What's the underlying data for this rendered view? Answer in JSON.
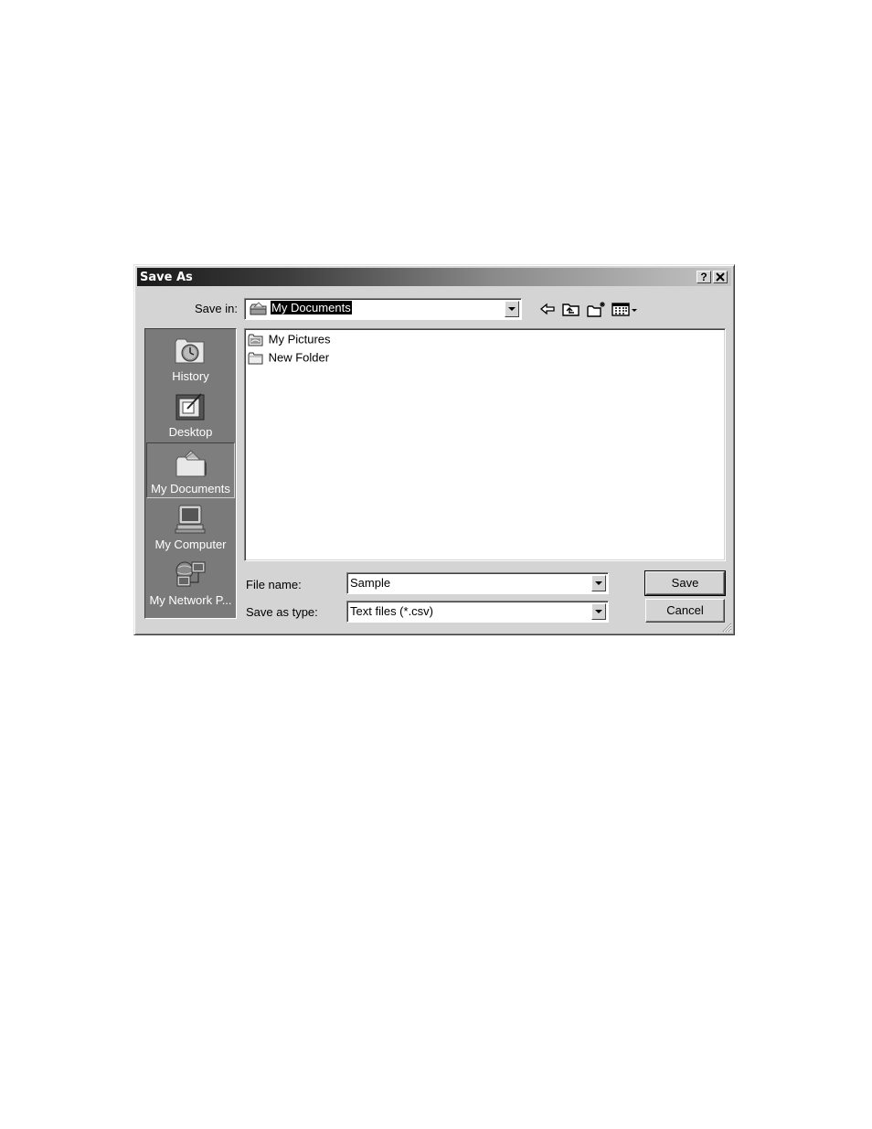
{
  "dialog": {
    "title": "Save As",
    "help_button": "?",
    "close_button": "✕"
  },
  "toolbar": {
    "save_in_label": "Save in:",
    "save_in_value": "My Documents",
    "save_in_icon": "my-documents-folder-icon",
    "buttons": [
      {
        "name": "back",
        "icon": "back-arrow-icon"
      },
      {
        "name": "up-one-level",
        "icon": "up-folder-icon"
      },
      {
        "name": "create-new-folder",
        "icon": "new-folder-icon"
      },
      {
        "name": "view-menu",
        "icon": "view-menu-icon"
      }
    ]
  },
  "places": [
    {
      "label": "History",
      "icon": "history-icon",
      "selected": false
    },
    {
      "label": "Desktop",
      "icon": "desktop-icon",
      "selected": false
    },
    {
      "label": "My Documents",
      "icon": "my-documents-icon",
      "selected": true
    },
    {
      "label": "My Computer",
      "icon": "my-computer-icon",
      "selected": false
    },
    {
      "label": "My Network P...",
      "icon": "my-network-places-icon",
      "selected": false
    }
  ],
  "files": [
    {
      "label": "My Pictures",
      "icon": "pictures-folder-icon"
    },
    {
      "label": "New Folder",
      "icon": "folder-icon"
    }
  ],
  "form": {
    "file_name_label": "File name:",
    "file_name_value": "Sample",
    "save_as_type_label": "Save as type:",
    "save_as_type_value": "Text files (*.csv)"
  },
  "buttons": {
    "save": "Save",
    "cancel": "Cancel"
  },
  "colors": {
    "dialog_face": "#d4d4d4",
    "places_bar": "#7a7a7a",
    "title_dark": "#1a1a1a",
    "title_light": "#c4c4c4"
  }
}
